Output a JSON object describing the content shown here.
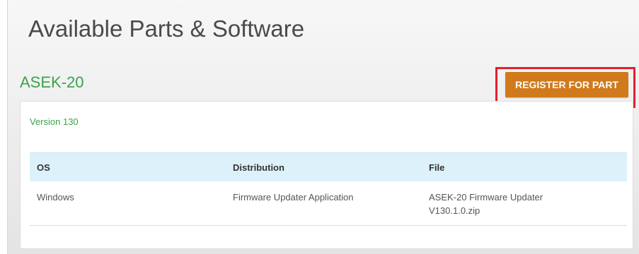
{
  "page": {
    "title": "Available Parts & Software"
  },
  "product": {
    "name": "ASEK-20",
    "register_label": "REGISTER FOR PART",
    "version": "Version 130"
  },
  "table": {
    "headers": [
      "OS",
      "Distribution",
      "File"
    ],
    "rows": [
      {
        "os": "Windows",
        "distribution": "Firmware Updater Application",
        "file": "ASEK-20 Firmware Updater V130.1.0.zip"
      }
    ]
  },
  "colors": {
    "accent_green": "#3aa34a",
    "button_orange": "#d17a1b",
    "highlight_red": "#e2202f",
    "table_header_bg": "#dcf1fa"
  }
}
